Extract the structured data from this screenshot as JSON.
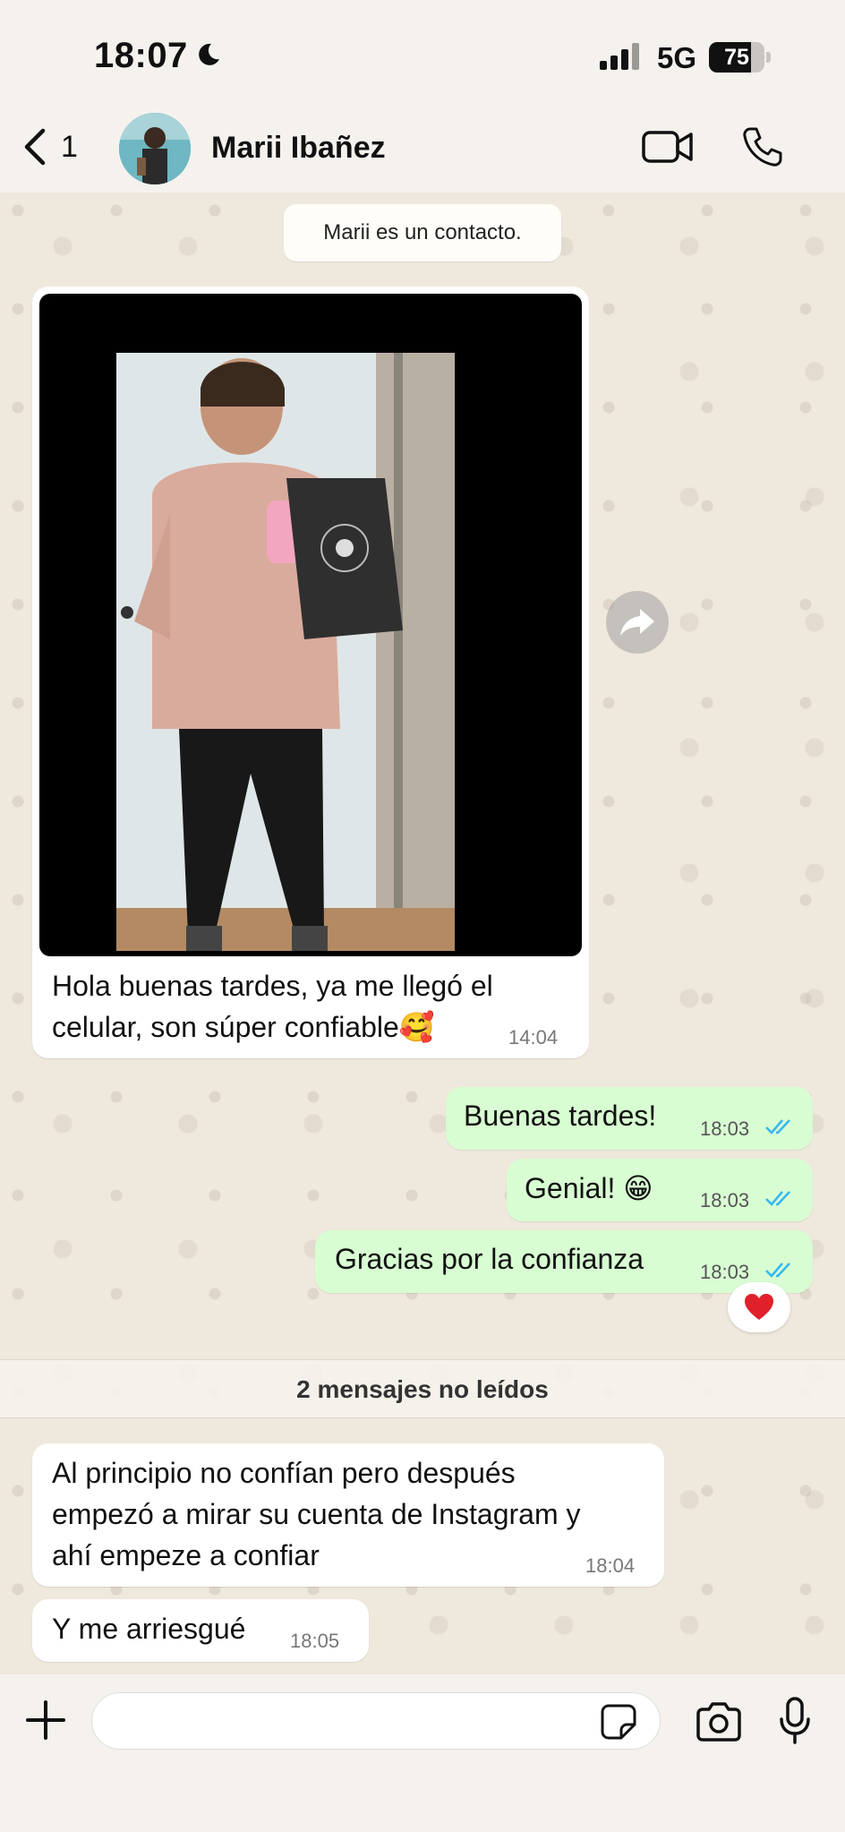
{
  "status_bar": {
    "time": "18:07",
    "network": "5G",
    "battery": "75",
    "battery_level": 0.75
  },
  "header": {
    "back_count": "1",
    "contact_name": "Marii Ibañez",
    "icons": [
      "chevron-left-icon",
      "video-call-icon",
      "phone-icon"
    ]
  },
  "system_message": "Marii es un contacto.",
  "messages": {
    "incoming_image": {
      "text_line1": "Hola buenas tardes, ya me llegó el",
      "text_line2": "celular, son súper confiable",
      "emoji": "🥰",
      "time": "14:04"
    },
    "outgoing": [
      {
        "text": "Buenas tardes!",
        "time": "18:03"
      },
      {
        "text": "Genial! ",
        "emoji": "😁",
        "time": "18:03"
      },
      {
        "text": "Gracias por la confianza",
        "time": "18:03"
      }
    ],
    "reaction": "heart-icon",
    "unread_banner": "2 mensajes no leídos",
    "incoming_after": [
      {
        "line1": "Al principio no confían pero después",
        "line2": "empezó a mirar su cuenta de Instagram y",
        "line3": "ahí empeze a confiar",
        "time": "18:04"
      },
      {
        "text": "Y me arriesgué",
        "time": "18:05"
      }
    ]
  },
  "colors": {
    "outgoing_bubble": "#d8fdd2",
    "incoming_bubble": "#ffffff",
    "read_ticks": "#34b7f1",
    "heart": "#e0202a"
  },
  "input": {
    "placeholder": ""
  }
}
